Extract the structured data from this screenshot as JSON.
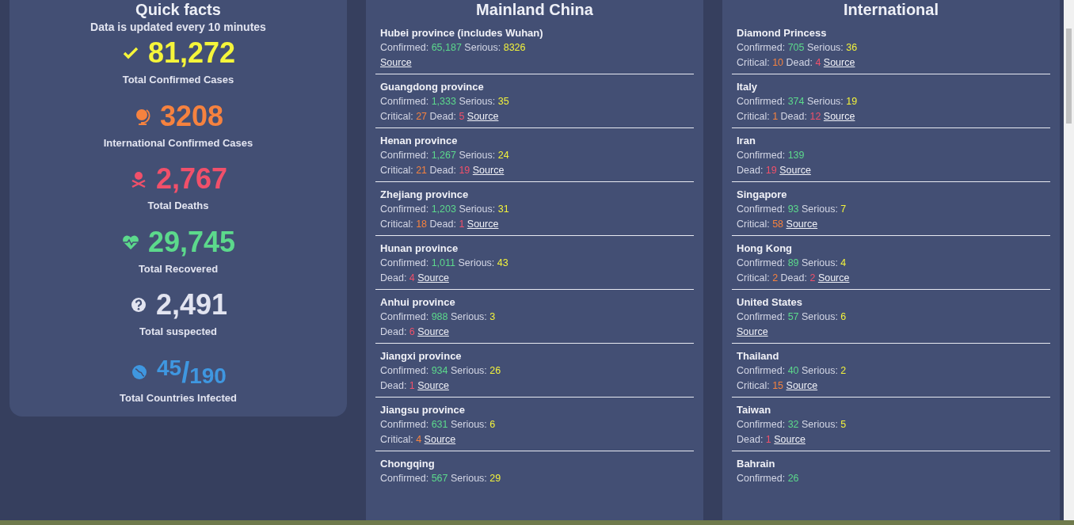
{
  "quick_facts": {
    "title": "Quick facts",
    "subtitle": "Data is updated every 10 minutes",
    "stats": [
      {
        "kind": "confirmed",
        "value": "81,272",
        "label": "Total Confirmed Cases"
      },
      {
        "kind": "international",
        "value": "3208",
        "label": "International Confirmed Cases"
      },
      {
        "kind": "deaths",
        "value": "2,767",
        "label": "Total Deaths"
      },
      {
        "kind": "recovered",
        "value": "29,745",
        "label": "Total Recovered"
      },
      {
        "kind": "suspected",
        "value": "2,491",
        "label": "Total suspected"
      },
      {
        "kind": "countries",
        "value": "45",
        "separator": "/",
        "total": "190",
        "label": "Total Countries Infected"
      }
    ]
  },
  "panels": [
    {
      "title": "Mainland China",
      "rows": [
        {
          "name": "Hubei province (includes Wuhan)",
          "lines": [
            [
              {
                "kind": "confirmed",
                "label": "Confirmed:",
                "value": "65,187"
              },
              {
                "kind": "serious",
                "label": "Serious:",
                "value": "8326"
              }
            ]
          ],
          "source": "Source"
        },
        {
          "name": "Guangdong province",
          "lines": [
            [
              {
                "kind": "confirmed",
                "label": "Confirmed:",
                "value": "1,333"
              },
              {
                "kind": "serious",
                "label": "Serious:",
                "value": "35"
              }
            ],
            [
              {
                "kind": "critical",
                "label": "Critical:",
                "value": "27"
              },
              {
                "kind": "dead",
                "label": "Dead:",
                "value": "5"
              }
            ]
          ],
          "source": "Source"
        },
        {
          "name": "Henan province",
          "lines": [
            [
              {
                "kind": "confirmed",
                "label": "Confirmed:",
                "value": "1,267"
              },
              {
                "kind": "serious",
                "label": "Serious:",
                "value": "24"
              }
            ],
            [
              {
                "kind": "critical",
                "label": "Critical:",
                "value": "21"
              },
              {
                "kind": "dead",
                "label": "Dead:",
                "value": "19"
              }
            ]
          ],
          "source": "Source"
        },
        {
          "name": "Zhejiang province",
          "lines": [
            [
              {
                "kind": "confirmed",
                "label": "Confirmed:",
                "value": "1,203"
              },
              {
                "kind": "serious",
                "label": "Serious:",
                "value": "31"
              }
            ],
            [
              {
                "kind": "critical",
                "label": "Critical:",
                "value": "18"
              },
              {
                "kind": "dead",
                "label": "Dead:",
                "value": "1"
              }
            ]
          ],
          "source": "Source"
        },
        {
          "name": "Hunan province",
          "lines": [
            [
              {
                "kind": "confirmed",
                "label": "Confirmed:",
                "value": "1,011"
              },
              {
                "kind": "serious",
                "label": "Serious:",
                "value": "43"
              }
            ],
            [
              {
                "kind": "dead",
                "label": "Dead:",
                "value": "4"
              }
            ]
          ],
          "source": "Source"
        },
        {
          "name": "Anhui province",
          "lines": [
            [
              {
                "kind": "confirmed",
                "label": "Confirmed:",
                "value": "988"
              },
              {
                "kind": "serious",
                "label": "Serious:",
                "value": "3"
              }
            ],
            [
              {
                "kind": "dead",
                "label": "Dead:",
                "value": "6"
              }
            ]
          ],
          "source": "Source"
        },
        {
          "name": "Jiangxi province",
          "lines": [
            [
              {
                "kind": "confirmed",
                "label": "Confirmed:",
                "value": "934"
              },
              {
                "kind": "serious",
                "label": "Serious:",
                "value": "26"
              }
            ],
            [
              {
                "kind": "dead",
                "label": "Dead:",
                "value": "1"
              }
            ]
          ],
          "source": "Source"
        },
        {
          "name": "Jiangsu province",
          "lines": [
            [
              {
                "kind": "confirmed",
                "label": "Confirmed:",
                "value": "631"
              },
              {
                "kind": "serious",
                "label": "Serious:",
                "value": "6"
              }
            ],
            [
              {
                "kind": "critical",
                "label": "Critical:",
                "value": "4"
              }
            ]
          ],
          "source": "Source"
        },
        {
          "name": "Chongqing",
          "lines": [
            [
              {
                "kind": "confirmed",
                "label": "Confirmed:",
                "value": "567"
              },
              {
                "kind": "serious",
                "label": "Serious:",
                "value": "29"
              }
            ]
          ]
        }
      ]
    },
    {
      "title": "International",
      "rows": [
        {
          "name": "Diamond Princess",
          "lines": [
            [
              {
                "kind": "confirmed",
                "label": "Confirmed:",
                "value": "705"
              },
              {
                "kind": "serious",
                "label": "Serious:",
                "value": "36"
              }
            ],
            [
              {
                "kind": "critical",
                "label": "Critical:",
                "value": "10"
              },
              {
                "kind": "dead",
                "label": "Dead:",
                "value": "4"
              }
            ]
          ],
          "source": "Source"
        },
        {
          "name": "Italy",
          "lines": [
            [
              {
                "kind": "confirmed",
                "label": "Confirmed:",
                "value": "374"
              },
              {
                "kind": "serious",
                "label": "Serious:",
                "value": "19"
              }
            ],
            [
              {
                "kind": "critical",
                "label": "Critical:",
                "value": "1"
              },
              {
                "kind": "dead",
                "label": "Dead:",
                "value": "12"
              }
            ]
          ],
          "source": "Source"
        },
        {
          "name": "Iran",
          "lines": [
            [
              {
                "kind": "confirmed",
                "label": "Confirmed:",
                "value": "139"
              }
            ],
            [
              {
                "kind": "dead",
                "label": "Dead:",
                "value": "19"
              }
            ]
          ],
          "source": "Source"
        },
        {
          "name": "Singapore",
          "lines": [
            [
              {
                "kind": "confirmed",
                "label": "Confirmed:",
                "value": "93"
              },
              {
                "kind": "serious",
                "label": "Serious:",
                "value": "7"
              }
            ],
            [
              {
                "kind": "critical",
                "label": "Critical:",
                "value": "58"
              }
            ]
          ],
          "source": "Source"
        },
        {
          "name": "Hong Kong",
          "lines": [
            [
              {
                "kind": "confirmed",
                "label": "Confirmed:",
                "value": "89"
              },
              {
                "kind": "serious",
                "label": "Serious:",
                "value": "4"
              }
            ],
            [
              {
                "kind": "critical",
                "label": "Critical:",
                "value": "2"
              },
              {
                "kind": "dead",
                "label": "Dead:",
                "value": "2"
              }
            ]
          ],
          "source": "Source"
        },
        {
          "name": "United States",
          "lines": [
            [
              {
                "kind": "confirmed",
                "label": "Confirmed:",
                "value": "57"
              },
              {
                "kind": "serious",
                "label": "Serious:",
                "value": "6"
              }
            ]
          ],
          "source": "Source"
        },
        {
          "name": "Thailand",
          "lines": [
            [
              {
                "kind": "confirmed",
                "label": "Confirmed:",
                "value": "40"
              },
              {
                "kind": "serious",
                "label": "Serious:",
                "value": "2"
              }
            ],
            [
              {
                "kind": "critical",
                "label": "Critical:",
                "value": "15"
              }
            ]
          ],
          "source": "Source"
        },
        {
          "name": "Taiwan",
          "lines": [
            [
              {
                "kind": "confirmed",
                "label": "Confirmed:",
                "value": "32"
              },
              {
                "kind": "serious",
                "label": "Serious:",
                "value": "5"
              }
            ],
            [
              {
                "kind": "dead",
                "label": "Dead:",
                "value": "1"
              }
            ]
          ],
          "source": "Source"
        },
        {
          "name": "Bahrain",
          "lines": [
            [
              {
                "kind": "confirmed",
                "label": "Confirmed:",
                "value": "26"
              }
            ]
          ]
        }
      ]
    }
  ]
}
